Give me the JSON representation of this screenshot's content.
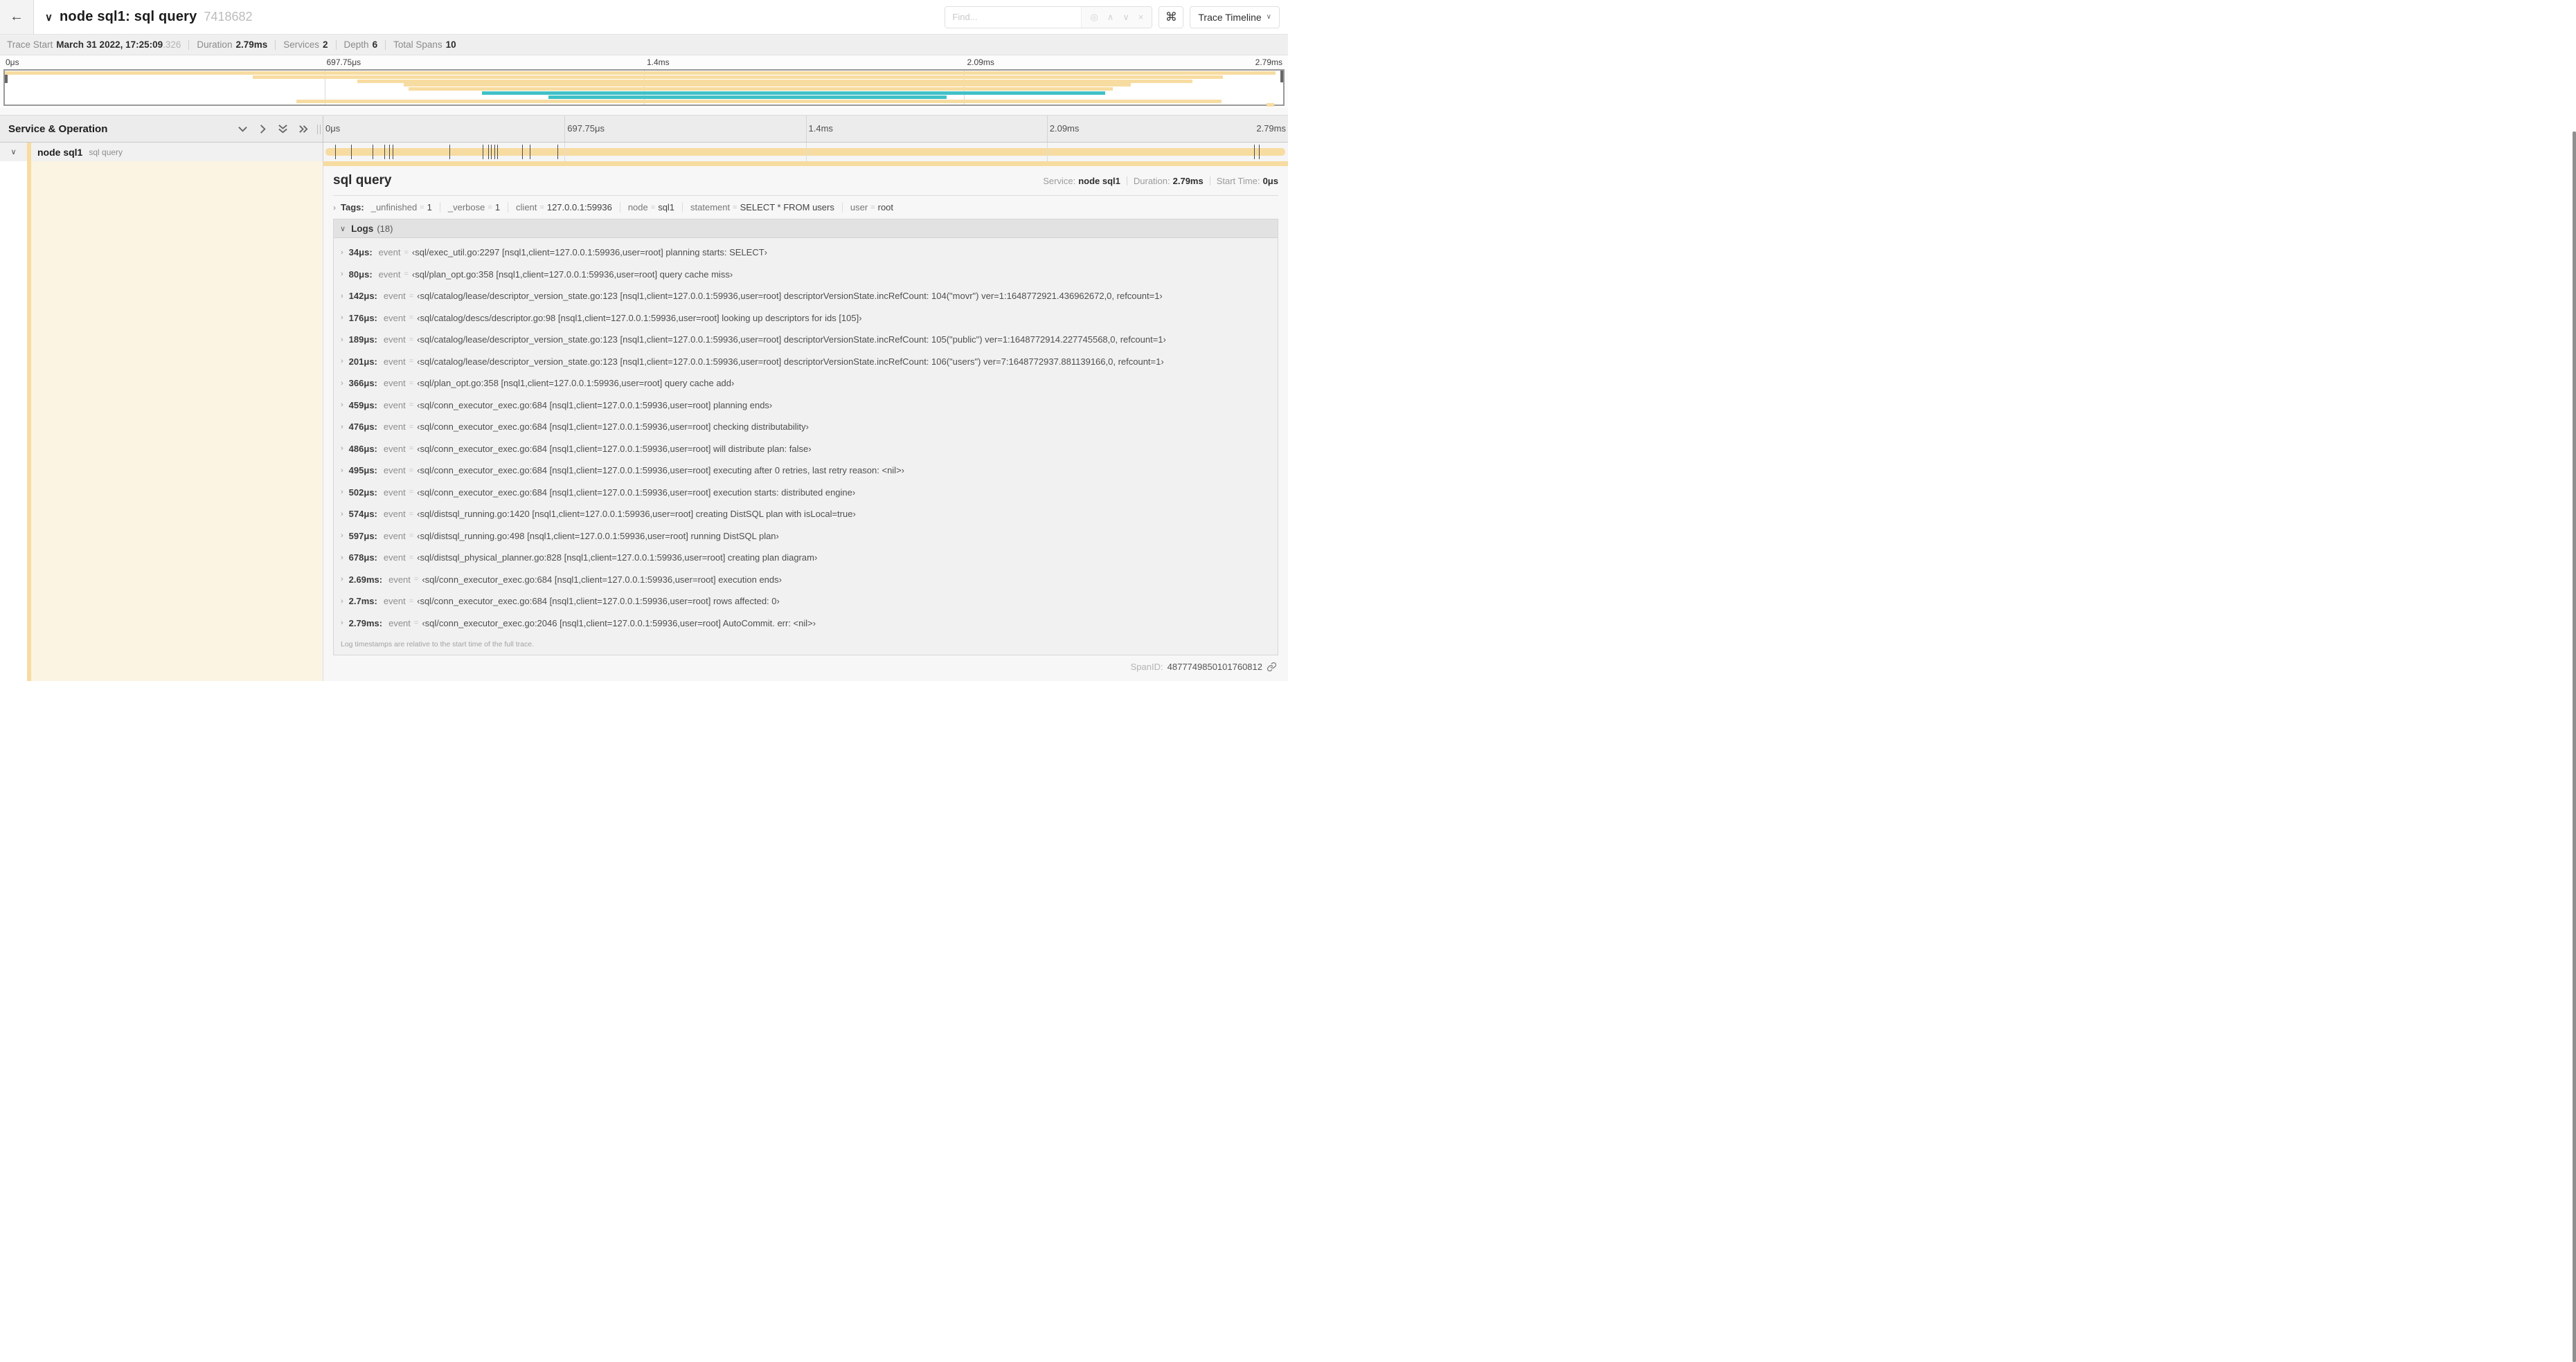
{
  "colors": {
    "span_tan": "#F7DCA1",
    "span_teal": "#41C1C8",
    "cream": "#FBF4E3"
  },
  "header": {
    "back_icon": "←",
    "collapse_chevron": "∨",
    "title": "node sql1: sql query",
    "trace_id": "7418682",
    "find_placeholder": "Find...",
    "find_icons": [
      "◎",
      "∧",
      "∨",
      "×"
    ],
    "shortcut_icon": "⌘",
    "view_select_label": "Trace Timeline",
    "view_select_caret": "∨"
  },
  "summary": {
    "items": [
      {
        "label": "Trace Start",
        "value": "March 31 2022, 17:25:09",
        "suffix": ".326"
      },
      {
        "label": "Duration",
        "value": "2.79ms"
      },
      {
        "label": "Services",
        "value": "2"
      },
      {
        "label": "Depth",
        "value": "6"
      },
      {
        "label": "Total Spans",
        "value": "10"
      }
    ]
  },
  "minimap": {
    "ticks": [
      "0μs",
      "697.75μs",
      "1.4ms",
      "2.09ms",
      "2.79ms"
    ],
    "grid_percents": [
      25,
      50,
      75
    ],
    "rows": [
      {
        "start": 0,
        "end": 99.4,
        "color": "tan"
      },
      {
        "start": 19.4,
        "end": 95.3,
        "color": "tan"
      },
      {
        "start": 27.6,
        "end": 92.9,
        "color": "tan"
      },
      {
        "start": 31.2,
        "end": 88.1,
        "color": "tan"
      },
      {
        "start": 31.6,
        "end": 86.7,
        "color": "tan"
      },
      {
        "start": 37.3,
        "end": 86.1,
        "color": "teal"
      },
      {
        "start": 42.5,
        "end": 73.7,
        "color": "teal"
      },
      {
        "start": 22.8,
        "end": 95.2,
        "color": "tan"
      },
      {
        "start": 98.7,
        "end": 99.3,
        "color": "tan"
      }
    ]
  },
  "timeline": {
    "left_header": "Service & Operation",
    "ruler_ticks": [
      "0μs",
      "697.75μs",
      "1.4ms",
      "2.09ms",
      "2.79ms"
    ],
    "span": {
      "chevron": "∨",
      "service": "node sql1",
      "operation": "sql query",
      "log_marks": [
        1.2,
        2.9,
        5.1,
        6.3,
        6.8,
        7.2,
        13.1,
        16.5,
        17.1,
        17.4,
        17.7,
        18.0,
        20.6,
        21.4,
        24.3,
        96.5,
        97.0
      ]
    }
  },
  "detail": {
    "operation": "sql query",
    "meta": [
      {
        "label": "Service:",
        "value": "node sql1"
      },
      {
        "label": "Duration:",
        "value": "2.79ms"
      },
      {
        "label": "Start Time:",
        "value": "0μs"
      }
    ],
    "tags_chevron": "›",
    "tags_label": "Tags:",
    "tags": [
      {
        "key": "_unfinished",
        "value": "1"
      },
      {
        "key": "_verbose",
        "value": "1"
      },
      {
        "key": "client",
        "value": "127.0.0.1:59936"
      },
      {
        "key": "node",
        "value": "sql1"
      },
      {
        "key": "statement",
        "value": "SELECT * FROM users"
      },
      {
        "key": "user",
        "value": "root"
      }
    ],
    "logs_chevron": "∨",
    "logs_label": "Logs",
    "logs_count": "(18)",
    "log_field": "event",
    "logs": [
      {
        "time": "34μs:",
        "value": "‹sql/exec_util.go:2297 [nsql1,client=127.0.0.1:59936,user=root] planning starts: SELECT›"
      },
      {
        "time": "80μs:",
        "value": "‹sql/plan_opt.go:358 [nsql1,client=127.0.0.1:59936,user=root] query cache miss›"
      },
      {
        "time": "142μs:",
        "value": "‹sql/catalog/lease/descriptor_version_state.go:123 [nsql1,client=127.0.0.1:59936,user=root] descriptorVersionState.incRefCount: 104(\"movr\") ver=1:1648772921.436962672,0, refcount=1›"
      },
      {
        "time": "176μs:",
        "value": "‹sql/catalog/descs/descriptor.go:98 [nsql1,client=127.0.0.1:59936,user=root] looking up descriptors for ids [105]›"
      },
      {
        "time": "189μs:",
        "value": "‹sql/catalog/lease/descriptor_version_state.go:123 [nsql1,client=127.0.0.1:59936,user=root] descriptorVersionState.incRefCount: 105(\"public\") ver=1:1648772914.227745568,0, refcount=1›"
      },
      {
        "time": "201μs:",
        "value": "‹sql/catalog/lease/descriptor_version_state.go:123 [nsql1,client=127.0.0.1:59936,user=root] descriptorVersionState.incRefCount: 106(\"users\") ver=7:1648772937.881139166,0, refcount=1›"
      },
      {
        "time": "366μs:",
        "value": "‹sql/plan_opt.go:358 [nsql1,client=127.0.0.1:59936,user=root] query cache add›"
      },
      {
        "time": "459μs:",
        "value": "‹sql/conn_executor_exec.go:684 [nsql1,client=127.0.0.1:59936,user=root] planning ends›"
      },
      {
        "time": "476μs:",
        "value": "‹sql/conn_executor_exec.go:684 [nsql1,client=127.0.0.1:59936,user=root] checking distributability›"
      },
      {
        "time": "486μs:",
        "value": "‹sql/conn_executor_exec.go:684 [nsql1,client=127.0.0.1:59936,user=root] will distribute plan: false›"
      },
      {
        "time": "495μs:",
        "value": "‹sql/conn_executor_exec.go:684 [nsql1,client=127.0.0.1:59936,user=root] executing after 0 retries, last retry reason: <nil>›"
      },
      {
        "time": "502μs:",
        "value": "‹sql/conn_executor_exec.go:684 [nsql1,client=127.0.0.1:59936,user=root] execution starts: distributed engine›"
      },
      {
        "time": "574μs:",
        "value": "‹sql/distsql_running.go:1420 [nsql1,client=127.0.0.1:59936,user=root] creating DistSQL plan with isLocal=true›"
      },
      {
        "time": "597μs:",
        "value": "‹sql/distsql_running.go:498 [nsql1,client=127.0.0.1:59936,user=root] running DistSQL plan›"
      },
      {
        "time": "678μs:",
        "value": "‹sql/distsql_physical_planner.go:828 [nsql1,client=127.0.0.1:59936,user=root] creating plan diagram›"
      },
      {
        "time": "2.69ms:",
        "value": "‹sql/conn_executor_exec.go:684 [nsql1,client=127.0.0.1:59936,user=root] execution ends›"
      },
      {
        "time": "2.7ms:",
        "value": "‹sql/conn_executor_exec.go:684 [nsql1,client=127.0.0.1:59936,user=root] rows affected: 0›"
      },
      {
        "time": "2.79ms:",
        "value": "‹sql/conn_executor_exec.go:2046 [nsql1,client=127.0.0.1:59936,user=root] AutoCommit. err: <nil>›"
      }
    ],
    "logs_note": "Log timestamps are relative to the start time of the full trace.",
    "spanid_label": "SpanID:",
    "spanid": "4877749850101760812"
  }
}
